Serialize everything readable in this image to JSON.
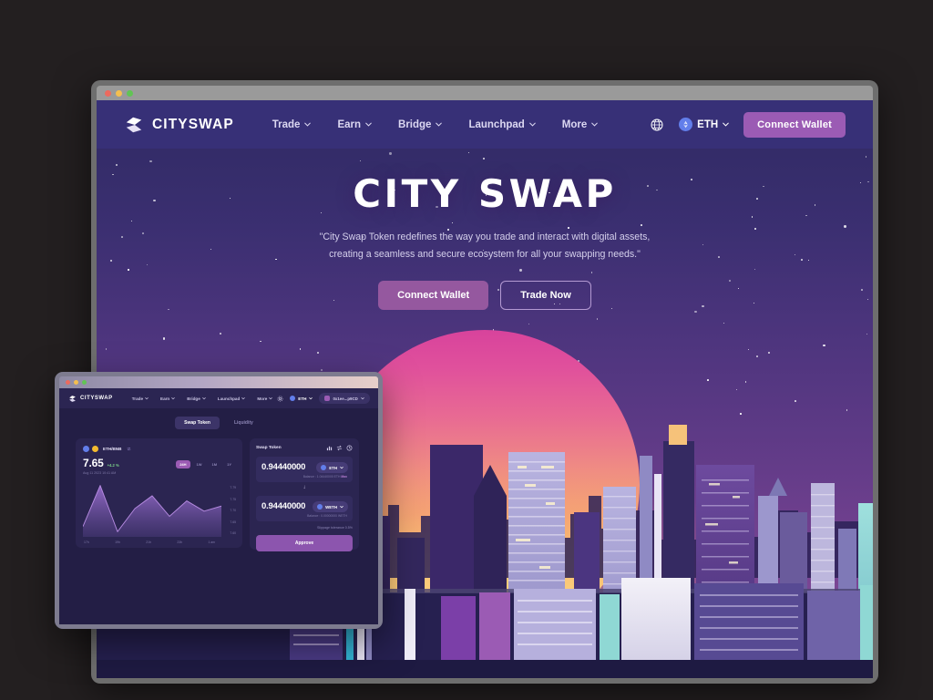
{
  "outer_window": {
    "traffic_lights": [
      "close",
      "minimize",
      "maximize"
    ]
  },
  "site": {
    "brand": "CITYSWAP",
    "nav": [
      {
        "label": "Trade",
        "has_caret": true
      },
      {
        "label": "Earn",
        "has_caret": true
      },
      {
        "label": "Bridge",
        "has_caret": true
      },
      {
        "label": "Launchpad",
        "has_caret": true
      },
      {
        "label": "More",
        "has_caret": true
      }
    ],
    "globe_icon": "globe-icon",
    "chain": {
      "label": "ETH",
      "icon": "ethereum-icon",
      "has_caret": true
    },
    "connect_wallet": "Connect Wallet"
  },
  "hero": {
    "title": "CITY SWAP",
    "subtitle_line1": "\"City Swap Token redefines the way you trade and interact with digital assets,",
    "subtitle_line2": "creating a seamless and secure ecosystem for all your swapping needs.\"",
    "primary_button": "Connect Wallet",
    "secondary_button": "Trade Now"
  },
  "app_window": {
    "brand": "CITYSWAP",
    "nav": [
      {
        "label": "Trade"
      },
      {
        "label": "Earn"
      },
      {
        "label": "Bridge"
      },
      {
        "label": "Launchpad"
      },
      {
        "label": "More"
      }
    ],
    "settings_icon": "gear-icon",
    "chain": {
      "label": "ETH",
      "icon": "ethereum-icon"
    },
    "wallet_address": "0x1ee...p9CD",
    "tabs": [
      {
        "label": "Swap Token",
        "active": true
      },
      {
        "label": "Liquidity",
        "active": false
      }
    ],
    "chart_card": {
      "pair": "ETH/BNB",
      "price": "7.65",
      "change": "+4.2 %",
      "timestamp": "Aug 11 2023 10:41 AM",
      "ranges": [
        {
          "label": "24H",
          "active": true
        },
        {
          "label": "1W",
          "active": false
        },
        {
          "label": "1M",
          "active": false
        },
        {
          "label": "1Y",
          "active": false
        }
      ]
    },
    "swap_card": {
      "title": "Swap Token",
      "icons": [
        "chart-icon",
        "swap-arrows-icon",
        "history-icon"
      ],
      "from": {
        "amount": "0.94440000",
        "token": "ETH",
        "token_icon": "ethereum-icon",
        "balance_label": "Balance : 1.04440000 ETH",
        "max_label": "Max"
      },
      "direction_icon": "arrow-down-icon",
      "to": {
        "amount": "0.94440000",
        "token": "WETH",
        "token_icon": "weth-icon",
        "balance_label": "Balance : 0.00000000 WETH"
      },
      "slippage_label": "Slippage tolerance",
      "slippage_value": "0.5%",
      "action_button": "Approve"
    }
  },
  "chart_data": {
    "type": "area",
    "title": "ETH/BNB",
    "xlabel": "",
    "ylabel": "",
    "x": [
      "17h",
      "19h",
      "21h",
      "23h",
      "1 am"
    ],
    "values": [
      7.62,
      7.78,
      7.6,
      7.69,
      7.74,
      7.66,
      7.72,
      7.68,
      7.7
    ],
    "y_ticks": [
      "7.79",
      "7.75",
      "7.70",
      "7.65",
      "7.60"
    ],
    "ylim": [
      7.58,
      7.8
    ],
    "grid": false,
    "legend": "none",
    "line_color": "#b07fd6",
    "fill_color": "#6f4a9c"
  },
  "theme": {
    "nav_bg": "#373077",
    "accent_purple": "#9b5bb4",
    "card_bg": "#2b2551",
    "app_bg": "#231e45",
    "sun_top": "#d8439c",
    "sun_bottom": "#fde08b",
    "sky_top": "#2f2a63",
    "sky_bottom": "#8a4d9c"
  }
}
